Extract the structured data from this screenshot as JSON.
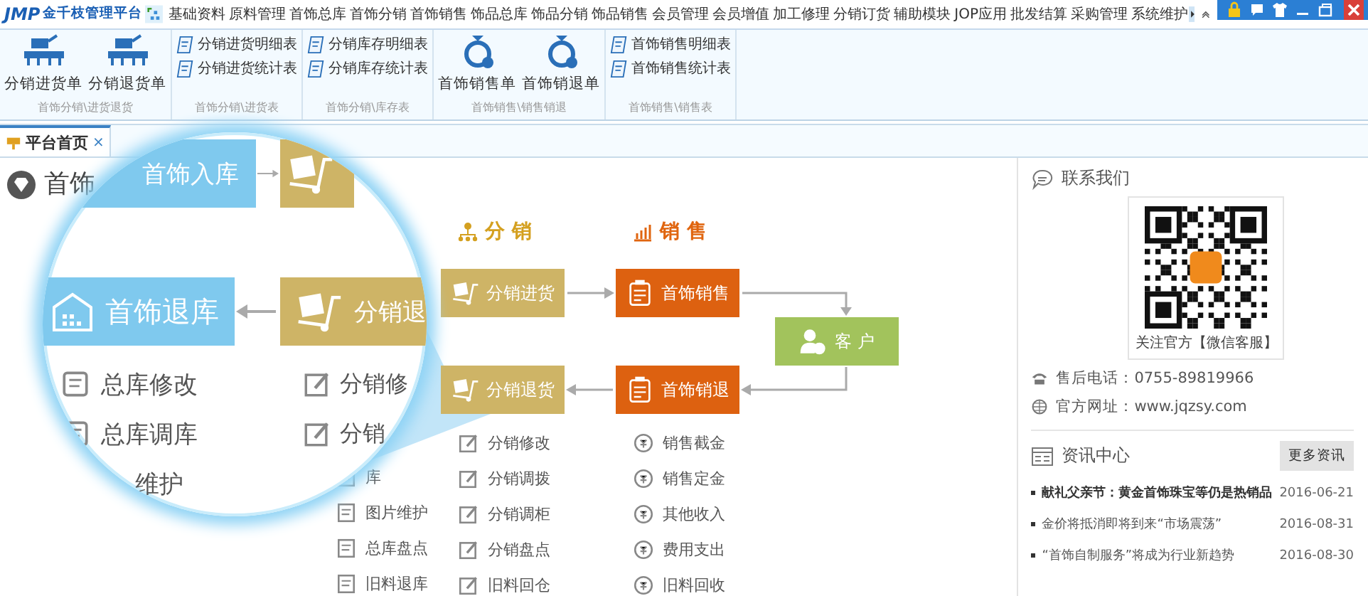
{
  "app": {
    "logo": "JMP",
    "name": "金千枝管理平台"
  },
  "menu": [
    "基础资料",
    "原料管理",
    "首饰总库",
    "首饰分销",
    "首饰销售",
    "饰品总库",
    "饰品分销",
    "饰品销售",
    "会员管理",
    "会员增值",
    "加工修理",
    "分销订货",
    "辅助模块",
    "JOP应用",
    "批发结算",
    "采购管理",
    "系统维护"
  ],
  "ribbon": [
    {
      "kind": "large",
      "buttons": [
        "分销进货单",
        "分销退货单"
      ],
      "caption": "首饰分销\\进货退货"
    },
    {
      "kind": "small",
      "buttons": [
        "分销进货明细表",
        "分销进货统计表"
      ],
      "caption": "首饰分销\\进货表"
    },
    {
      "kind": "small",
      "buttons": [
        "分销库存明细表",
        "分销库存统计表"
      ],
      "caption": "首饰分销\\库存表"
    },
    {
      "kind": "large",
      "buttons": [
        "首饰销售单",
        "首饰销退单"
      ],
      "caption": "首饰销售\\销售销退"
    },
    {
      "kind": "small",
      "buttons": [
        "首饰销售明细表",
        "首饰销售统计表"
      ],
      "caption": "首饰销售\\销售表"
    }
  ],
  "tabs": [
    {
      "label": "平台首页",
      "close": "×",
      "selected": true
    }
  ],
  "page_title": "首饰",
  "magnifier": {
    "stock_in": "首饰入库",
    "stock_return": "首饰退库",
    "dist_return": "分销退",
    "links_left": [
      "总库修改",
      "总库调库",
      "维护"
    ],
    "links_right": [
      "分销修",
      "分销"
    ]
  },
  "flow": {
    "headings": [
      {
        "kind": "distribution",
        "label": "分 销"
      },
      {
        "kind": "sales",
        "label": "销 售"
      }
    ],
    "nodes": [
      {
        "kind": "distribution",
        "label": "分销进货"
      },
      {
        "kind": "sales",
        "label": "首饰销售"
      },
      {
        "kind": "customer",
        "label": "客 户"
      },
      {
        "kind": "distribution",
        "label": "分销退货"
      },
      {
        "kind": "sales",
        "label": "首饰销退"
      }
    ],
    "left_links": [
      "库",
      "图片维护",
      "总库盘点",
      "旧料退库"
    ],
    "distribution_links": [
      "分销修改",
      "分销调拨",
      "分销调柜",
      "分销盘点",
      "旧料回仓"
    ],
    "sales_links": [
      "销售截金",
      "销售定金",
      "其他收入",
      "费用支出",
      "旧料回收"
    ]
  },
  "contact": {
    "heading": "联系我们",
    "qr_caption": "关注官方【微信客服】",
    "phone": "售后电话：0755-89819966",
    "website": "官方网址：www.jqzsy.com"
  },
  "news": {
    "heading": "资讯中心",
    "more_button": "更多资讯",
    "items": [
      {
        "title": "献礼父亲节：黄金首饰珠宝等仍是热销品",
        "date": "2016-06-21"
      },
      {
        "title": "金价将抵消即将到来“市场震荡”",
        "date": "2016-08-31"
      },
      {
        "title": "“首饰自制服务”将成为行业新趋势",
        "date": "2016-08-30"
      }
    ]
  }
}
